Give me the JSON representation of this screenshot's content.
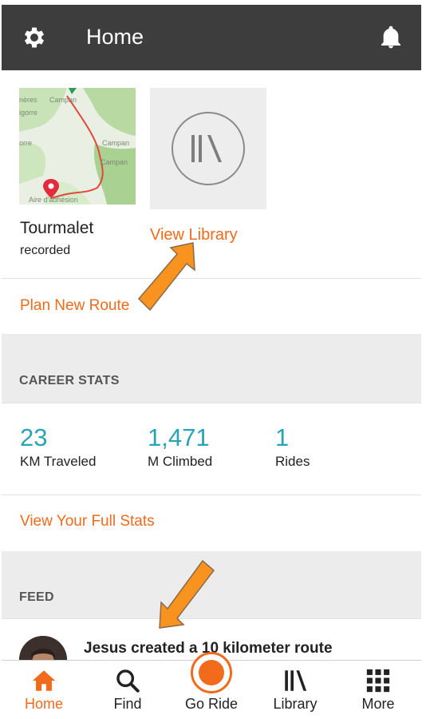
{
  "header": {
    "title": "Home",
    "left_icon": "gear-icon",
    "right_icon": "bell-icon",
    "background": "#3d3d3d"
  },
  "recent_route": {
    "name": "Tourmalet",
    "status": "recorded",
    "map_labels": [
      "nères",
      "Campan",
      "igorre",
      "orre",
      "Campan",
      "Campan",
      "Aire d'adhésion"
    ]
  },
  "library": {
    "icon": "library-icon",
    "link_label": "View Library"
  },
  "plan_route_label": "Plan New Route",
  "career_stats": {
    "section_label": "CAREER STATS",
    "stats": [
      {
        "value": "23",
        "label": "KM Traveled"
      },
      {
        "value": "1,471",
        "label": "M Climbed"
      },
      {
        "value": "1",
        "label": "Rides"
      }
    ],
    "full_stats_label": "View Your Full Stats"
  },
  "feed": {
    "section_label": "FEED",
    "items": [
      {
        "text": "Jesus created a 10 kilometer route"
      }
    ]
  },
  "bottom_nav": {
    "items": [
      {
        "label": "Home",
        "icon": "home-icon",
        "active": true
      },
      {
        "label": "Find",
        "icon": "search-icon",
        "active": false
      },
      {
        "label": "Go Ride",
        "icon": "record-icon",
        "active": false
      },
      {
        "label": "Library",
        "icon": "library-icon",
        "active": false
      },
      {
        "label": "More",
        "icon": "grid-icon",
        "active": false
      }
    ]
  },
  "colors": {
    "accent": "#f26a1b",
    "stat_teal": "#29a4b4",
    "annotation_arrow": "#f7931e"
  }
}
